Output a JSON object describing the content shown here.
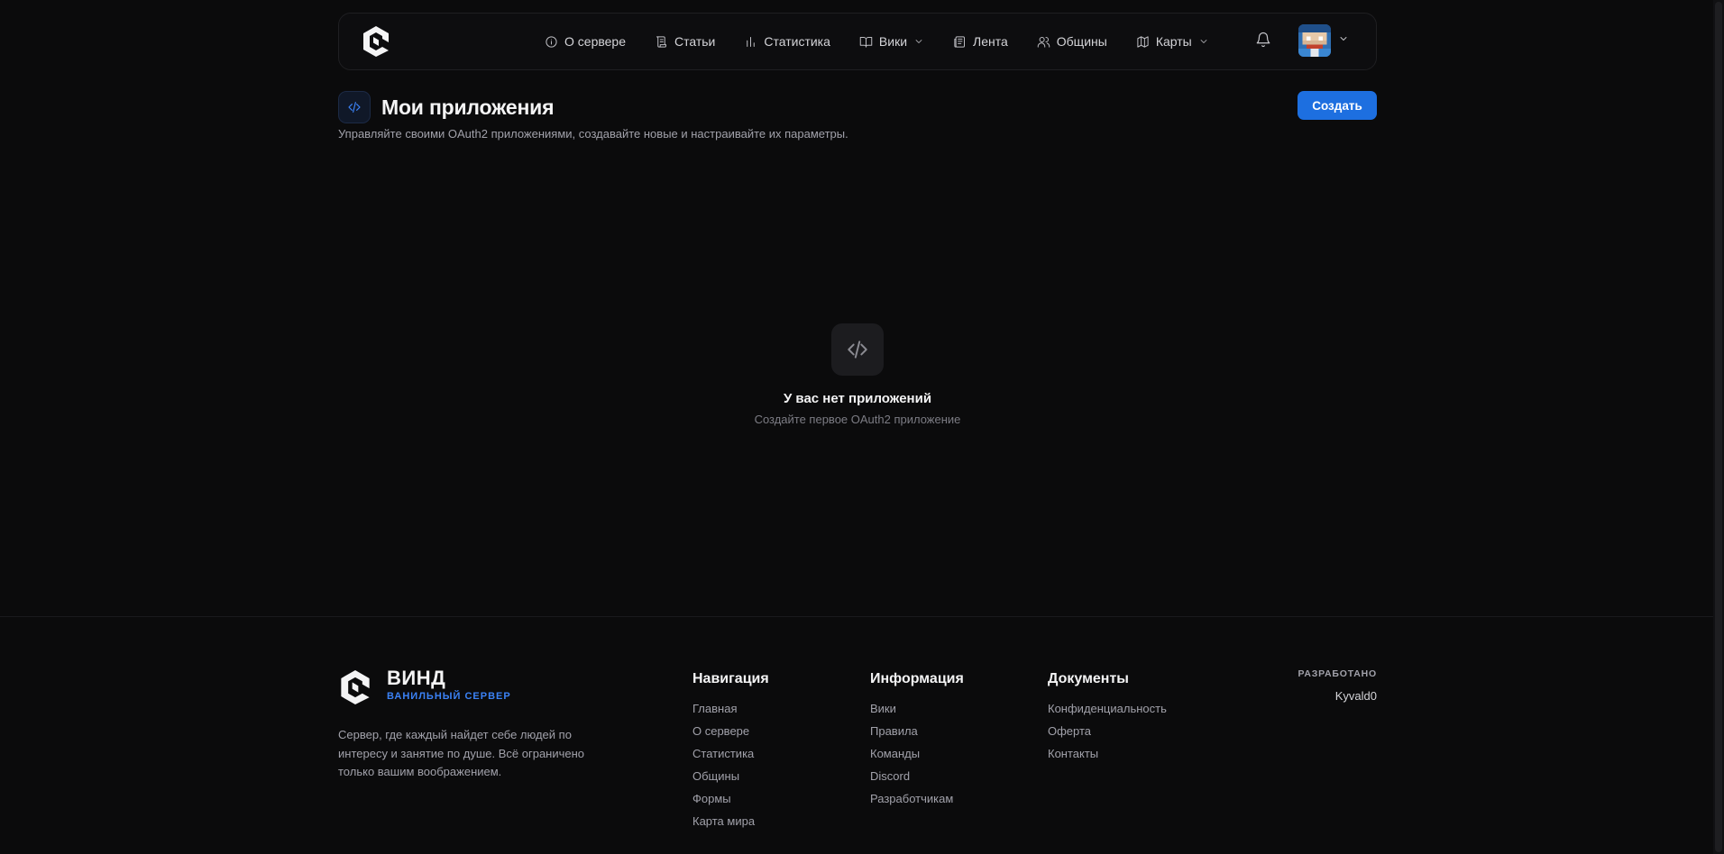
{
  "header": {
    "nav": [
      {
        "label": "О сервере",
        "icon": "info-icon"
      },
      {
        "label": "Статьи",
        "icon": "scroll-icon"
      },
      {
        "label": "Статистика",
        "icon": "bar-chart-icon"
      },
      {
        "label": "Вики",
        "icon": "book-icon",
        "dropdown": true
      },
      {
        "label": "Лента",
        "icon": "newspaper-icon"
      },
      {
        "label": "Общины",
        "icon": "users-icon"
      },
      {
        "label": "Карты",
        "icon": "map-icon",
        "dropdown": true
      }
    ]
  },
  "page": {
    "title": "Мои приложения",
    "subtitle": "Управляйте своими OAuth2 приложениями, создавайте новые и настраивайте их параметры.",
    "create_label": "Создать"
  },
  "empty_state": {
    "title": "У вас нет приложений",
    "subtitle": "Создайте первое OAuth2 приложение"
  },
  "footer": {
    "brand": "ВИНД",
    "tagline": "ВАНИЛЬНЫЙ СЕРВЕР",
    "description": "Сервер, где каждый найдет себе людей по интересу и занятие по душе. Всё ограничено только вашим воображением.",
    "columns": [
      {
        "title": "Навигация",
        "links": [
          "Главная",
          "О сервере",
          "Статистика",
          "Общины",
          "Формы",
          "Карта мира"
        ]
      },
      {
        "title": "Информация",
        "links": [
          "Вики",
          "Правила",
          "Команды",
          "Discord",
          "Разработчикам"
        ]
      },
      {
        "title": "Документы",
        "links": [
          "Конфиденциальность",
          "Оферта",
          "Контакты"
        ]
      }
    ],
    "made_by_label": "РАЗРАБОТАНО",
    "made_by_name": "Kyvald0"
  },
  "colors": {
    "accent": "#1d6fe0",
    "brand_tag": "#3b82f6",
    "background": "#0b0b0c"
  }
}
